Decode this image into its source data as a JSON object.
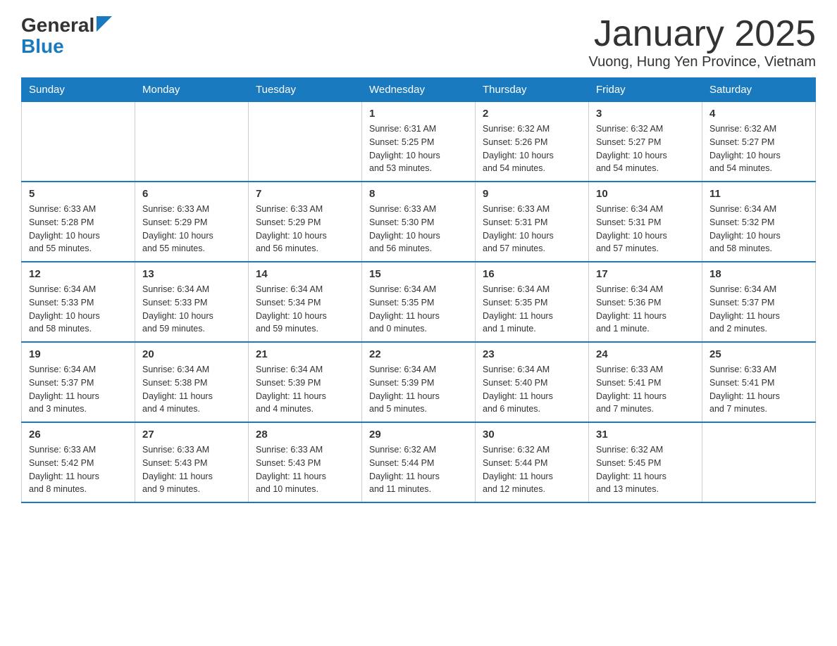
{
  "header": {
    "logo_general": "General",
    "logo_blue": "Blue",
    "title": "January 2025",
    "subtitle": "Vuong, Hung Yen Province, Vietnam"
  },
  "calendar": {
    "days_of_week": [
      "Sunday",
      "Monday",
      "Tuesday",
      "Wednesday",
      "Thursday",
      "Friday",
      "Saturday"
    ],
    "weeks": [
      [
        {
          "date": "",
          "info": ""
        },
        {
          "date": "",
          "info": ""
        },
        {
          "date": "",
          "info": ""
        },
        {
          "date": "1",
          "info": "Sunrise: 6:31 AM\nSunset: 5:25 PM\nDaylight: 10 hours\nand 53 minutes."
        },
        {
          "date": "2",
          "info": "Sunrise: 6:32 AM\nSunset: 5:26 PM\nDaylight: 10 hours\nand 54 minutes."
        },
        {
          "date": "3",
          "info": "Sunrise: 6:32 AM\nSunset: 5:27 PM\nDaylight: 10 hours\nand 54 minutes."
        },
        {
          "date": "4",
          "info": "Sunrise: 6:32 AM\nSunset: 5:27 PM\nDaylight: 10 hours\nand 54 minutes."
        }
      ],
      [
        {
          "date": "5",
          "info": "Sunrise: 6:33 AM\nSunset: 5:28 PM\nDaylight: 10 hours\nand 55 minutes."
        },
        {
          "date": "6",
          "info": "Sunrise: 6:33 AM\nSunset: 5:29 PM\nDaylight: 10 hours\nand 55 minutes."
        },
        {
          "date": "7",
          "info": "Sunrise: 6:33 AM\nSunset: 5:29 PM\nDaylight: 10 hours\nand 56 minutes."
        },
        {
          "date": "8",
          "info": "Sunrise: 6:33 AM\nSunset: 5:30 PM\nDaylight: 10 hours\nand 56 minutes."
        },
        {
          "date": "9",
          "info": "Sunrise: 6:33 AM\nSunset: 5:31 PM\nDaylight: 10 hours\nand 57 minutes."
        },
        {
          "date": "10",
          "info": "Sunrise: 6:34 AM\nSunset: 5:31 PM\nDaylight: 10 hours\nand 57 minutes."
        },
        {
          "date": "11",
          "info": "Sunrise: 6:34 AM\nSunset: 5:32 PM\nDaylight: 10 hours\nand 58 minutes."
        }
      ],
      [
        {
          "date": "12",
          "info": "Sunrise: 6:34 AM\nSunset: 5:33 PM\nDaylight: 10 hours\nand 58 minutes."
        },
        {
          "date": "13",
          "info": "Sunrise: 6:34 AM\nSunset: 5:33 PM\nDaylight: 10 hours\nand 59 minutes."
        },
        {
          "date": "14",
          "info": "Sunrise: 6:34 AM\nSunset: 5:34 PM\nDaylight: 10 hours\nand 59 minutes."
        },
        {
          "date": "15",
          "info": "Sunrise: 6:34 AM\nSunset: 5:35 PM\nDaylight: 11 hours\nand 0 minutes."
        },
        {
          "date": "16",
          "info": "Sunrise: 6:34 AM\nSunset: 5:35 PM\nDaylight: 11 hours\nand 1 minute."
        },
        {
          "date": "17",
          "info": "Sunrise: 6:34 AM\nSunset: 5:36 PM\nDaylight: 11 hours\nand 1 minute."
        },
        {
          "date": "18",
          "info": "Sunrise: 6:34 AM\nSunset: 5:37 PM\nDaylight: 11 hours\nand 2 minutes."
        }
      ],
      [
        {
          "date": "19",
          "info": "Sunrise: 6:34 AM\nSunset: 5:37 PM\nDaylight: 11 hours\nand 3 minutes."
        },
        {
          "date": "20",
          "info": "Sunrise: 6:34 AM\nSunset: 5:38 PM\nDaylight: 11 hours\nand 4 minutes."
        },
        {
          "date": "21",
          "info": "Sunrise: 6:34 AM\nSunset: 5:39 PM\nDaylight: 11 hours\nand 4 minutes."
        },
        {
          "date": "22",
          "info": "Sunrise: 6:34 AM\nSunset: 5:39 PM\nDaylight: 11 hours\nand 5 minutes."
        },
        {
          "date": "23",
          "info": "Sunrise: 6:34 AM\nSunset: 5:40 PM\nDaylight: 11 hours\nand 6 minutes."
        },
        {
          "date": "24",
          "info": "Sunrise: 6:33 AM\nSunset: 5:41 PM\nDaylight: 11 hours\nand 7 minutes."
        },
        {
          "date": "25",
          "info": "Sunrise: 6:33 AM\nSunset: 5:41 PM\nDaylight: 11 hours\nand 7 minutes."
        }
      ],
      [
        {
          "date": "26",
          "info": "Sunrise: 6:33 AM\nSunset: 5:42 PM\nDaylight: 11 hours\nand 8 minutes."
        },
        {
          "date": "27",
          "info": "Sunrise: 6:33 AM\nSunset: 5:43 PM\nDaylight: 11 hours\nand 9 minutes."
        },
        {
          "date": "28",
          "info": "Sunrise: 6:33 AM\nSunset: 5:43 PM\nDaylight: 11 hours\nand 10 minutes."
        },
        {
          "date": "29",
          "info": "Sunrise: 6:32 AM\nSunset: 5:44 PM\nDaylight: 11 hours\nand 11 minutes."
        },
        {
          "date": "30",
          "info": "Sunrise: 6:32 AM\nSunset: 5:44 PM\nDaylight: 11 hours\nand 12 minutes."
        },
        {
          "date": "31",
          "info": "Sunrise: 6:32 AM\nSunset: 5:45 PM\nDaylight: 11 hours\nand 13 minutes."
        },
        {
          "date": "",
          "info": ""
        }
      ]
    ]
  }
}
